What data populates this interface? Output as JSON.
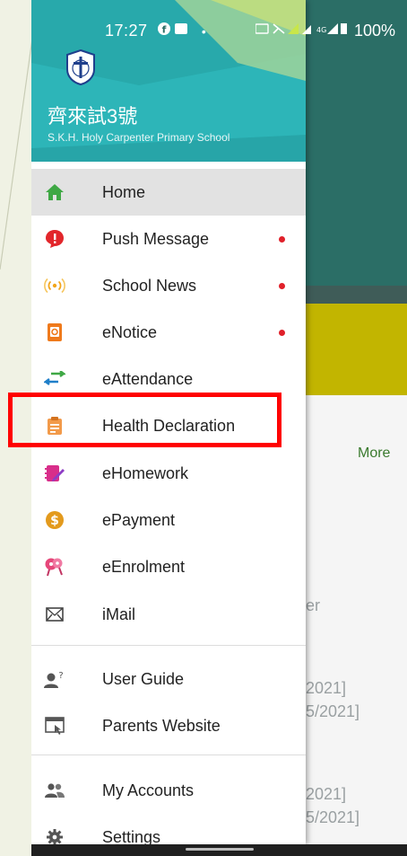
{
  "status_bar": {
    "time": "17:27",
    "left_icons": "•",
    "battery": "100%"
  },
  "school": {
    "name_zh": "齊來試3號",
    "name_en": "S.K.H. Holy Carpenter Primary School"
  },
  "menu": [
    {
      "label": "Home",
      "icon": "home-icon",
      "active": true,
      "badge": false
    },
    {
      "label": "Push Message",
      "icon": "push-message-icon",
      "active": false,
      "badge": true
    },
    {
      "label": "School News",
      "icon": "broadcast-icon",
      "active": false,
      "badge": true
    },
    {
      "label": "eNotice",
      "icon": "notice-icon",
      "active": false,
      "badge": true
    },
    {
      "label": "eAttendance",
      "icon": "attendance-arrows-icon",
      "active": false,
      "badge": false
    },
    {
      "label": "Health Declaration",
      "icon": "clipboard-icon",
      "active": false,
      "badge": false
    },
    {
      "label": "eHomework",
      "icon": "homework-icon",
      "active": false,
      "badge": false
    },
    {
      "label": "ePayment",
      "icon": "dollar-icon",
      "active": false,
      "badge": false
    },
    {
      "label": "eEnrolment",
      "icon": "enrolment-icon",
      "active": false,
      "badge": false
    },
    {
      "label": "iMail",
      "icon": "mail-icon",
      "active": false,
      "badge": false
    },
    {
      "label": "User Guide",
      "icon": "user-guide-icon",
      "active": false,
      "badge": false
    },
    {
      "label": "Parents Website",
      "icon": "website-icon",
      "active": false,
      "badge": false
    },
    {
      "label": "My Accounts",
      "icon": "accounts-icon",
      "active": false,
      "badge": false
    },
    {
      "label": "Settings",
      "icon": "gear-icon",
      "active": false,
      "badge": false
    }
  ],
  "background_app": {
    "more_label": "More",
    "fragments": [
      "er",
      "2021]",
      "5/2021]",
      "2021]",
      "5/2021]"
    ]
  },
  "colors": {
    "header": "#2db5b8",
    "badge": "#e0202a",
    "highlight": "#ff0000",
    "more": "#3a7a2e"
  }
}
